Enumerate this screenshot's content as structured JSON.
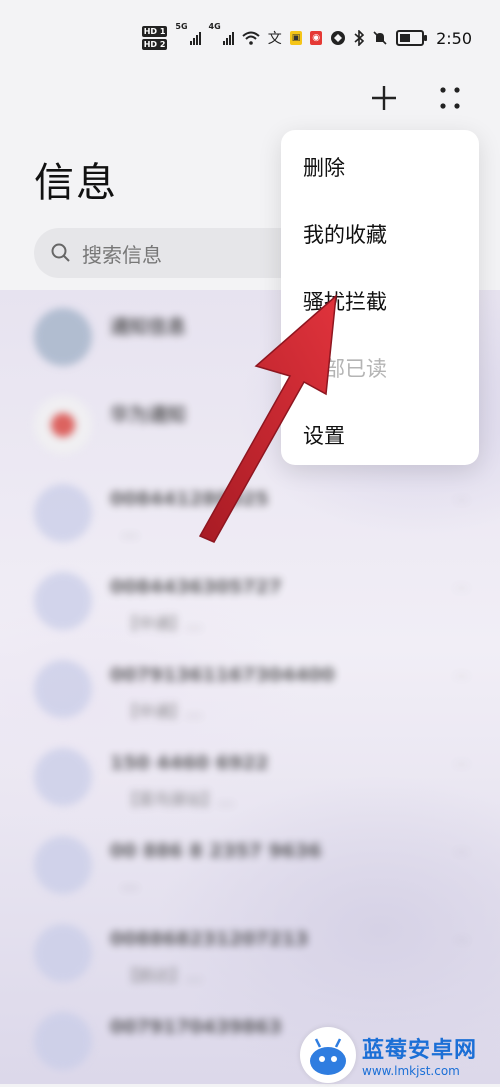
{
  "status_bar": {
    "hd1": "HD 1",
    "hd2": "HD 2",
    "net1": "5G",
    "net2": "4G",
    "time": "2:50",
    "icons": [
      "signal-icon",
      "signal-icon",
      "wifi-icon",
      "app-badge-wen",
      "app-badge-pay",
      "app-badge-red",
      "vpn-icon",
      "bluetooth-icon",
      "mute-icon",
      "battery-icon"
    ]
  },
  "header": {
    "title": "信息",
    "add_icon": "plus-icon",
    "more_icon": "more-dots-icon"
  },
  "search": {
    "placeholder": "搜索信息",
    "icon": "search-icon"
  },
  "conversations": [
    {
      "name": "通知信息",
      "preview": "",
      "time": "",
      "avatar": "notice"
    },
    {
      "name": "华为通知",
      "preview": "",
      "time": "",
      "avatar": "huawei"
    },
    {
      "name": "008441280025",
      "preview": "…",
      "time": "…",
      "avatar": "contact"
    },
    {
      "name": "008443630572​7",
      "preview": "【中通】…",
      "time": "…",
      "avatar": "contact"
    },
    {
      "name": "00791361167304400",
      "preview": "【中通】…",
      "time": "…",
      "avatar": "contact"
    },
    {
      "name": "150 4460 6922",
      "preview": "【菜鸟驿站】…",
      "time": "…",
      "avatar": "contact"
    },
    {
      "name": "00 886 8 2357 9636",
      "preview": "…",
      "time": "…",
      "avatar": "contact"
    },
    {
      "name": "008868231207213",
      "preview": "【韵达】…",
      "time": "…",
      "avatar": "contact"
    },
    {
      "name": "0079170439863",
      "preview": "",
      "time": "",
      "avatar": "contact"
    }
  ],
  "menu": {
    "items": [
      {
        "label": "删除",
        "enabled": true
      },
      {
        "label": "我的收藏",
        "enabled": true
      },
      {
        "label": "骚扰拦截",
        "enabled": true
      },
      {
        "label": "全部已读",
        "enabled": false
      },
      {
        "label": "设置",
        "enabled": true
      }
    ]
  },
  "annotation": {
    "arrow_color": "#c8232c"
  },
  "watermark": {
    "title": "蓝莓安卓网",
    "url": "www.lmkjst.com"
  }
}
